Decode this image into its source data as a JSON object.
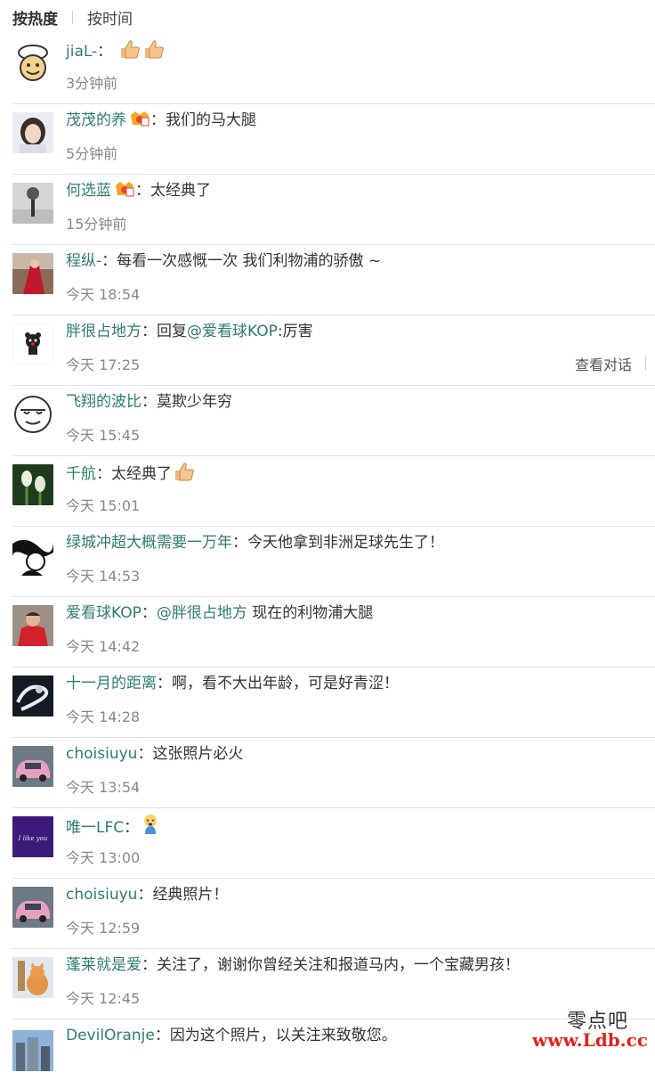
{
  "sort_tabs": {
    "hot": "按热度",
    "time": "按时间"
  },
  "comments": [
    {
      "user": "jiaL-",
      "sep": "：",
      "text": "",
      "emoji": "thumbs-up-icon x2",
      "time": "3分钟前",
      "avatar": "chef-avatar"
    },
    {
      "user": "茂茂的养",
      "sep": "：",
      "text": "我们的马大腿",
      "badge": "member-badge-icon",
      "time": "5分钟前",
      "avatar": "girl-avatar"
    },
    {
      "user": "何选蓝",
      "sep": "：",
      "text": "太经典了",
      "badge": "member-badge-icon",
      "time": "15分钟前",
      "avatar": "tree-avatar"
    },
    {
      "user": "程纵-",
      "sep": "：",
      "text": "每看一次感慨一次 我们利物浦的骄傲 ~",
      "time": "今天 18:54",
      "avatar": "red-avatar"
    },
    {
      "user": "胖很占地方",
      "sep": "：",
      "text_prefix": "回复",
      "mention": "@爱看球KOP",
      "text": ":厉害",
      "time": "今天 17:25",
      "link": "查看对话",
      "avatar": "bear-avatar"
    },
    {
      "user": "飞翔的波比",
      "sep": "：",
      "text": "莫欺少年穷",
      "time": "今天 15:45",
      "avatar": "face-avatar"
    },
    {
      "user": "千航",
      "sep": "：",
      "text": "太经典了",
      "emoji": "thumbs-up-icon",
      "time": "今天 15:01",
      "avatar": "tulip-avatar"
    },
    {
      "user": "绿城冲超大概需要一万年",
      "sep": "：",
      "text": "今天他拿到非洲足球先生了！",
      "time": "今天 14:53",
      "avatar": "art-avatar"
    },
    {
      "user": "爱看球KOP",
      "sep": "：",
      "mention": "@胖很占地方",
      "text": " 现在的利物浦大腿",
      "time": "今天 14:42",
      "avatar": "player-avatar"
    },
    {
      "user": "十一月的距离",
      "sep": "：",
      "text": "啊，看不大出年龄，可是好青涩！",
      "time": "今天 14:28",
      "avatar": "swirl-avatar"
    },
    {
      "user": "choisiuyu",
      "sep": "：",
      "text": "这张照片必火",
      "time": "今天 13:54",
      "avatar": "car-avatar"
    },
    {
      "user": "唯一LFC",
      "sep": "：",
      "text": "",
      "emoji": "crying-icon",
      "time": "今天 13:00",
      "avatar": "text-avatar",
      "avatar_text": "I like you"
    },
    {
      "user": "choisiuyu",
      "sep": "：",
      "text": "经典照片！",
      "time": "今天 12:59",
      "avatar": "car-avatar"
    },
    {
      "user": "蓬莱就是爱",
      "sep": "：",
      "text": "关注了，谢谢你曾经关注和报道马内，一个宝藏男孩！",
      "time": "今天 12:45",
      "avatar": "cat-avatar"
    },
    {
      "user": "DevilOranje",
      "sep": "：",
      "text": "因为这个照片，以关注来致敬您。",
      "time": "",
      "avatar": "city-avatar"
    }
  ],
  "watermark": {
    "top": "零点吧",
    "bottom": "www.Ldb.cc"
  },
  "colors": {
    "username": "#2e7d6b",
    "time": "#888888",
    "watermark_red": "#e2231a"
  }
}
